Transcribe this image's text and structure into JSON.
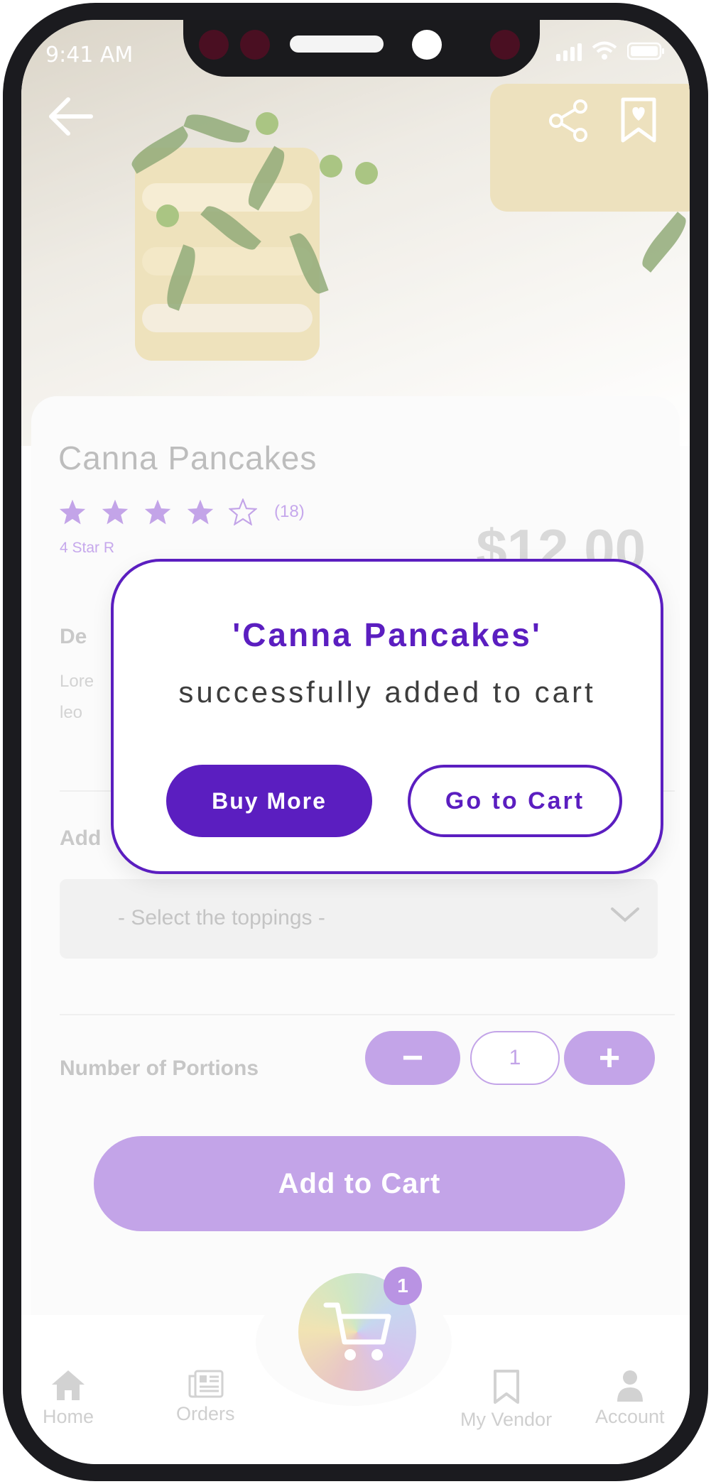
{
  "status_bar": {
    "time": "9:41 AM"
  },
  "product": {
    "name": "Canna Pancakes",
    "rating": 4,
    "rating_max": 5,
    "review_count": "(18)",
    "rating_caption": "4 Star R",
    "price": "$12.00",
    "description_label": "De",
    "description_text": "Lore\nleo"
  },
  "addons": {
    "label": "Add",
    "toppings_placeholder": "- Select the toppings -"
  },
  "portions": {
    "label": "Number of Portions",
    "quantity": "1",
    "decrement_label": "−",
    "increment_label": "+"
  },
  "add_to_cart_label": "Add to Cart",
  "modal": {
    "title": "'Canna Pancakes'",
    "message": "successfully added to cart",
    "buy_more_label": "Buy More",
    "go_to_cart_label": "Go to Cart"
  },
  "cart": {
    "badge_count": "1"
  },
  "tabs": {
    "home": "Home",
    "orders": "Orders",
    "vendor": "My Vendor",
    "account": "Account"
  },
  "colors": {
    "accent": "#5b1ec0",
    "accent_light": "#c3a4e8"
  },
  "icons": [
    "back-arrow-icon",
    "share-icon",
    "bookmark-heart-icon",
    "star-icon",
    "chevron-down-icon",
    "cart-icon",
    "home-icon",
    "orders-icon",
    "bookmark-icon",
    "account-icon"
  ]
}
